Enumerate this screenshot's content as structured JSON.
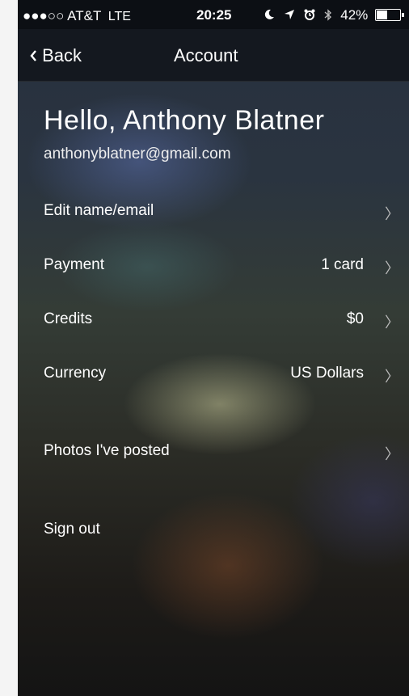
{
  "status_bar": {
    "signal": "●●●○○",
    "carrier": "AT&T",
    "network": "LTE",
    "time": "20:25",
    "battery": "42%",
    "battery_level": 0.42
  },
  "nav": {
    "back_label": "Back",
    "title": "Account"
  },
  "profile": {
    "greeting": "Hello, Anthony Blatner",
    "email": "anthonyblatner@gmail.com"
  },
  "rows": [
    {
      "label": "Edit name/email",
      "value": ""
    },
    {
      "label": "Payment",
      "value": "1 card"
    },
    {
      "label": "Credits",
      "value": "$0"
    },
    {
      "label": "Currency",
      "value": "US Dollars"
    },
    {
      "label": "Photos I've posted",
      "value": ""
    },
    {
      "label": "Sign out"
    }
  ],
  "icons": {
    "back": "chevron-left-icon",
    "row_chevron": "chevron-right-icon",
    "moon": "moon-icon",
    "location": "location-arrow-icon",
    "alarm": "alarm-icon",
    "bluetooth": "bluetooth-icon",
    "battery": "battery-icon"
  }
}
